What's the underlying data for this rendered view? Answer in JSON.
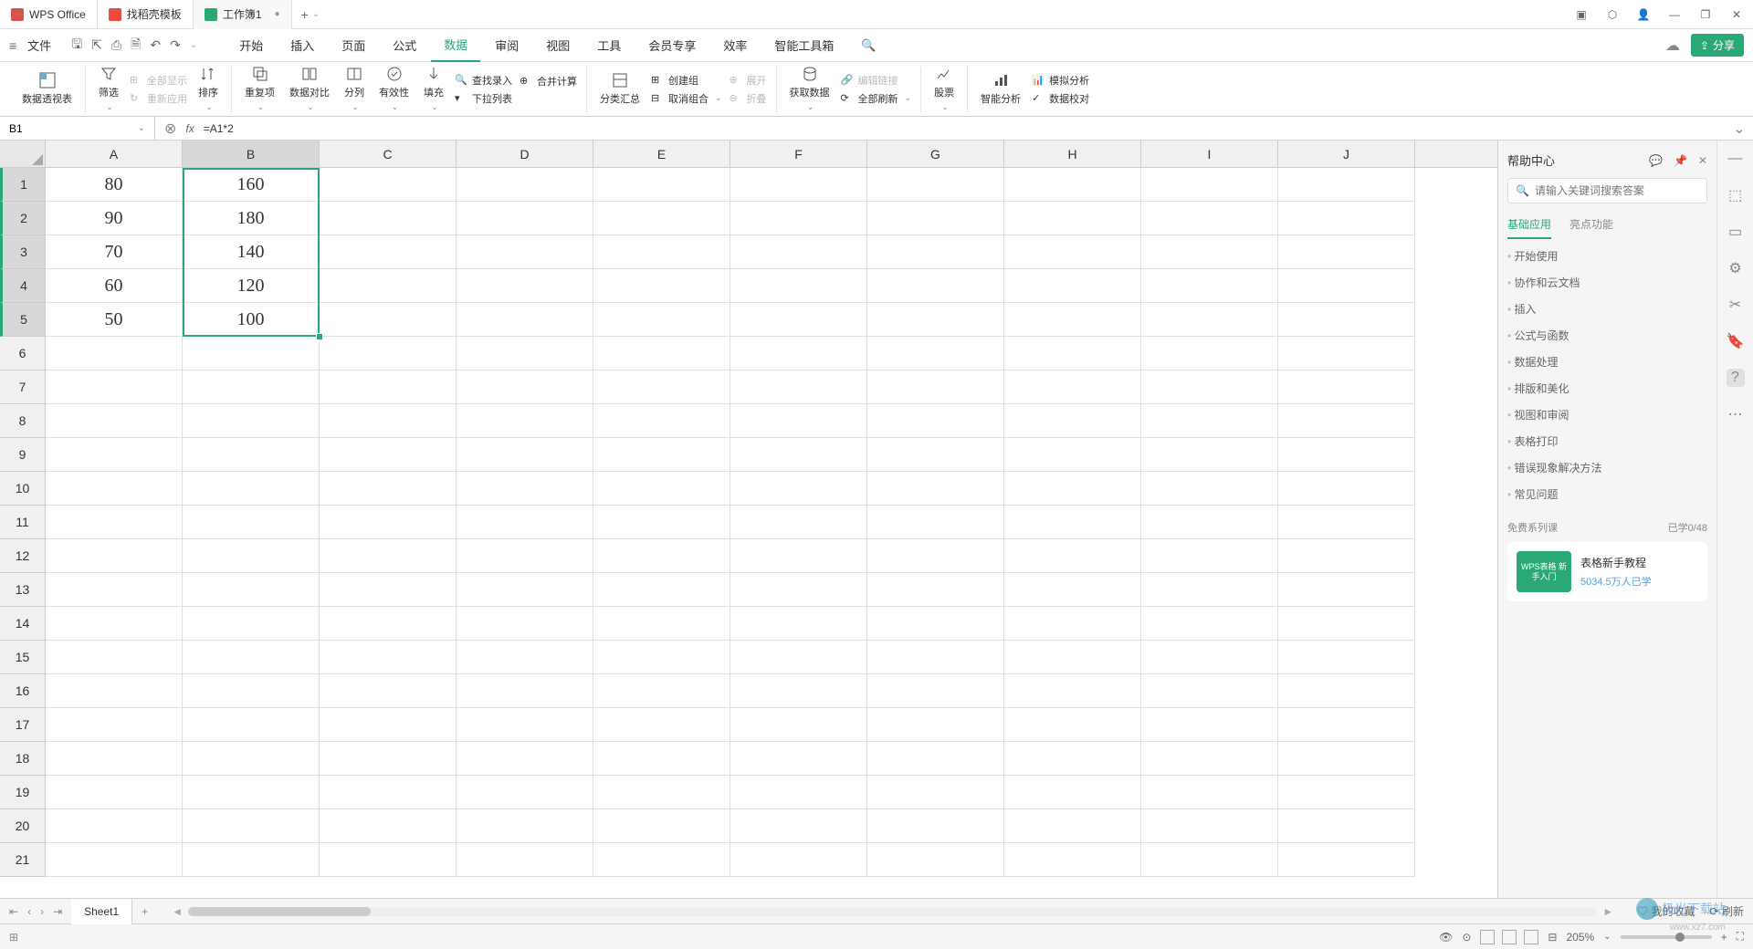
{
  "titlebar": {
    "tabs": [
      {
        "label": "WPS Office",
        "icon": "wps"
      },
      {
        "label": "找稻壳模板",
        "icon": "template"
      },
      {
        "label": "工作簿1",
        "icon": "sheet",
        "active": true
      }
    ],
    "add": "+"
  },
  "menubar": {
    "file": "文件",
    "tabs": [
      "开始",
      "插入",
      "页面",
      "公式",
      "数据",
      "审阅",
      "视图",
      "工具",
      "会员专享",
      "效率",
      "智能工具箱"
    ],
    "active": "数据",
    "share": "分享"
  },
  "ribbon": {
    "pivot": "数据透视表",
    "filter": "筛选",
    "show_all": "全部显示",
    "reapply": "重新应用",
    "sort": "排序",
    "duplicates": "重复项",
    "compare": "数据对比",
    "split": "分列",
    "validate": "有效性",
    "fill": "填充",
    "dropdown": "下拉列表",
    "find_input": "查找录入",
    "consolidate": "合并计算",
    "subtotal": "分类汇总",
    "group": "创建组",
    "ungroup": "取消组合",
    "expand": "展开",
    "collapse": "折叠",
    "get_data": "获取数据",
    "refresh_all": "全部刷新",
    "edit_link": "编辑链接",
    "stock": "股票",
    "analysis": "智能分析",
    "simulation": "模拟分析",
    "data_check": "数据校对"
  },
  "formula": {
    "cell_ref": "B1",
    "formula": "=A1*2"
  },
  "columns": [
    "A",
    "B",
    "C",
    "D",
    "E",
    "F",
    "G",
    "H",
    "I",
    "J"
  ],
  "grid": {
    "A": [
      "80",
      "90",
      "70",
      "60",
      "50"
    ],
    "B": [
      "160",
      "180",
      "140",
      "120",
      "100"
    ]
  },
  "row_count": 21,
  "help": {
    "title": "帮助中心",
    "search_placeholder": "请输入关键词搜索答案",
    "tabs": [
      "基础应用",
      "亮点功能"
    ],
    "items": [
      "开始使用",
      "协作和云文档",
      "插入",
      "公式与函数",
      "数据处理",
      "排版和美化",
      "视图和审阅",
      "表格打印",
      "错误现象解决方法",
      "常见问题"
    ],
    "course_head": "免费系列课",
    "course_progress": "已学0/48",
    "course_thumb": "WPS表格 新手入门",
    "course_title": "表格新手教程",
    "course_sub": "5034.5万人已学",
    "favorite": "我的收藏",
    "refresh": "刷新"
  },
  "sheet_tabs": {
    "name": "Sheet1",
    "add": "+"
  },
  "status": {
    "zoom": "205%"
  },
  "watermark": {
    "main": "极光下载站",
    "sub": "www.xz7.com"
  }
}
